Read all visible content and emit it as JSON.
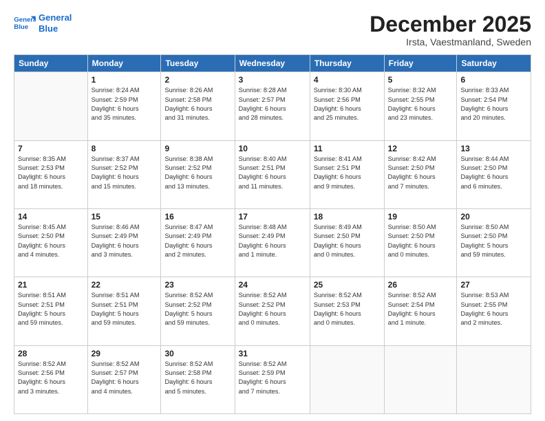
{
  "header": {
    "logo_line1": "General",
    "logo_line2": "Blue",
    "title": "December 2025",
    "subtitle": "Irsta, Vaestmanland, Sweden"
  },
  "calendar": {
    "headers": [
      "Sunday",
      "Monday",
      "Tuesday",
      "Wednesday",
      "Thursday",
      "Friday",
      "Saturday"
    ],
    "weeks": [
      [
        {
          "day": "",
          "detail": ""
        },
        {
          "day": "1",
          "detail": "Sunrise: 8:24 AM\nSunset: 2:59 PM\nDaylight: 6 hours\nand 35 minutes."
        },
        {
          "day": "2",
          "detail": "Sunrise: 8:26 AM\nSunset: 2:58 PM\nDaylight: 6 hours\nand 31 minutes."
        },
        {
          "day": "3",
          "detail": "Sunrise: 8:28 AM\nSunset: 2:57 PM\nDaylight: 6 hours\nand 28 minutes."
        },
        {
          "day": "4",
          "detail": "Sunrise: 8:30 AM\nSunset: 2:56 PM\nDaylight: 6 hours\nand 25 minutes."
        },
        {
          "day": "5",
          "detail": "Sunrise: 8:32 AM\nSunset: 2:55 PM\nDaylight: 6 hours\nand 23 minutes."
        },
        {
          "day": "6",
          "detail": "Sunrise: 8:33 AM\nSunset: 2:54 PM\nDaylight: 6 hours\nand 20 minutes."
        }
      ],
      [
        {
          "day": "7",
          "detail": "Sunrise: 8:35 AM\nSunset: 2:53 PM\nDaylight: 6 hours\nand 18 minutes."
        },
        {
          "day": "8",
          "detail": "Sunrise: 8:37 AM\nSunset: 2:52 PM\nDaylight: 6 hours\nand 15 minutes."
        },
        {
          "day": "9",
          "detail": "Sunrise: 8:38 AM\nSunset: 2:52 PM\nDaylight: 6 hours\nand 13 minutes."
        },
        {
          "day": "10",
          "detail": "Sunrise: 8:40 AM\nSunset: 2:51 PM\nDaylight: 6 hours\nand 11 minutes."
        },
        {
          "day": "11",
          "detail": "Sunrise: 8:41 AM\nSunset: 2:51 PM\nDaylight: 6 hours\nand 9 minutes."
        },
        {
          "day": "12",
          "detail": "Sunrise: 8:42 AM\nSunset: 2:50 PM\nDaylight: 6 hours\nand 7 minutes."
        },
        {
          "day": "13",
          "detail": "Sunrise: 8:44 AM\nSunset: 2:50 PM\nDaylight: 6 hours\nand 6 minutes."
        }
      ],
      [
        {
          "day": "14",
          "detail": "Sunrise: 8:45 AM\nSunset: 2:50 PM\nDaylight: 6 hours\nand 4 minutes."
        },
        {
          "day": "15",
          "detail": "Sunrise: 8:46 AM\nSunset: 2:49 PM\nDaylight: 6 hours\nand 3 minutes."
        },
        {
          "day": "16",
          "detail": "Sunrise: 8:47 AM\nSunset: 2:49 PM\nDaylight: 6 hours\nand 2 minutes."
        },
        {
          "day": "17",
          "detail": "Sunrise: 8:48 AM\nSunset: 2:49 PM\nDaylight: 6 hours\nand 1 minute."
        },
        {
          "day": "18",
          "detail": "Sunrise: 8:49 AM\nSunset: 2:50 PM\nDaylight: 6 hours\nand 0 minutes."
        },
        {
          "day": "19",
          "detail": "Sunrise: 8:50 AM\nSunset: 2:50 PM\nDaylight: 6 hours\nand 0 minutes."
        },
        {
          "day": "20",
          "detail": "Sunrise: 8:50 AM\nSunset: 2:50 PM\nDaylight: 5 hours\nand 59 minutes."
        }
      ],
      [
        {
          "day": "21",
          "detail": "Sunrise: 8:51 AM\nSunset: 2:51 PM\nDaylight: 5 hours\nand 59 minutes."
        },
        {
          "day": "22",
          "detail": "Sunrise: 8:51 AM\nSunset: 2:51 PM\nDaylight: 5 hours\nand 59 minutes."
        },
        {
          "day": "23",
          "detail": "Sunrise: 8:52 AM\nSunset: 2:52 PM\nDaylight: 5 hours\nand 59 minutes."
        },
        {
          "day": "24",
          "detail": "Sunrise: 8:52 AM\nSunset: 2:52 PM\nDaylight: 6 hours\nand 0 minutes."
        },
        {
          "day": "25",
          "detail": "Sunrise: 8:52 AM\nSunset: 2:53 PM\nDaylight: 6 hours\nand 0 minutes."
        },
        {
          "day": "26",
          "detail": "Sunrise: 8:52 AM\nSunset: 2:54 PM\nDaylight: 6 hours\nand 1 minute."
        },
        {
          "day": "27",
          "detail": "Sunrise: 8:53 AM\nSunset: 2:55 PM\nDaylight: 6 hours\nand 2 minutes."
        }
      ],
      [
        {
          "day": "28",
          "detail": "Sunrise: 8:52 AM\nSunset: 2:56 PM\nDaylight: 6 hours\nand 3 minutes."
        },
        {
          "day": "29",
          "detail": "Sunrise: 8:52 AM\nSunset: 2:57 PM\nDaylight: 6 hours\nand 4 minutes."
        },
        {
          "day": "30",
          "detail": "Sunrise: 8:52 AM\nSunset: 2:58 PM\nDaylight: 6 hours\nand 5 minutes."
        },
        {
          "day": "31",
          "detail": "Sunrise: 8:52 AM\nSunset: 2:59 PM\nDaylight: 6 hours\nand 7 minutes."
        },
        {
          "day": "",
          "detail": ""
        },
        {
          "day": "",
          "detail": ""
        },
        {
          "day": "",
          "detail": ""
        }
      ]
    ]
  }
}
